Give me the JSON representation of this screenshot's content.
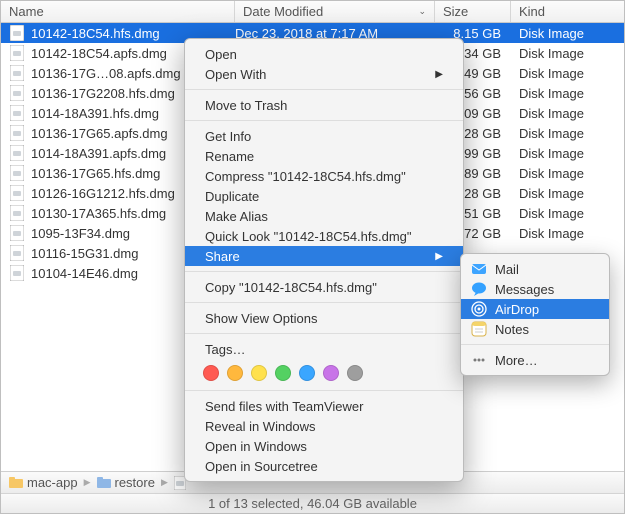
{
  "columns": {
    "name": "Name",
    "date": "Date Modified",
    "size": "Size",
    "kind": "Kind"
  },
  "sort_column": "date",
  "files": [
    {
      "name": "10142-18C54.hfs.dmg",
      "date": "Dec 23, 2018 at 7:17 AM",
      "size": "8.15 GB",
      "kind": "Disk Image",
      "selected": true
    },
    {
      "name": "10142-18C54.apfs.dmg",
      "date": "",
      "size": "34 GB",
      "kind": "Disk Image"
    },
    {
      "name": "10136-17G…08.apfs.dmg",
      "date": "",
      "size": "49 GB",
      "kind": "Disk Image"
    },
    {
      "name": "10136-17G2208.hfs.dmg",
      "date": "",
      "size": "56 GB",
      "kind": "Disk Image"
    },
    {
      "name": "1014-18A391.hfs.dmg",
      "date": "",
      "size": "09 GB",
      "kind": "Disk Image"
    },
    {
      "name": "10136-17G65.apfs.dmg",
      "date": "",
      "size": "28 GB",
      "kind": "Disk Image"
    },
    {
      "name": "1014-18A391.apfs.dmg",
      "date": "",
      "size": "99 GB",
      "kind": "Disk Image"
    },
    {
      "name": "10136-17G65.hfs.dmg",
      "date": "",
      "size": "89 GB",
      "kind": "Disk Image"
    },
    {
      "name": "10126-16G1212.hfs.dmg",
      "date": "",
      "size": "28 GB",
      "kind": "Disk Image"
    },
    {
      "name": "10130-17A365.hfs.dmg",
      "date": "",
      "size": "51 GB",
      "kind": "Disk Image"
    },
    {
      "name": "1095-13F34.dmg",
      "date": "",
      "size": "72 GB",
      "kind": "Disk Image"
    },
    {
      "name": "10116-15G31.dmg",
      "date": "",
      "size": "",
      "kind": ""
    },
    {
      "name": "10104-14E46.dmg",
      "date": "",
      "size": "",
      "kind": ""
    }
  ],
  "ctx": {
    "open": "Open",
    "open_with": "Open With",
    "trash": "Move to Trash",
    "get_info": "Get Info",
    "rename": "Rename",
    "compress": "Compress \"10142-18C54.hfs.dmg\"",
    "duplicate": "Duplicate",
    "alias": "Make Alias",
    "quicklook": "Quick Look \"10142-18C54.hfs.dmg\"",
    "share": "Share",
    "copy": "Copy \"10142-18C54.hfs.dmg\"",
    "view_opts": "Show View Options",
    "tags": "Tags…",
    "teamviewer": "Send files with TeamViewer",
    "reveal": "Reveal in Windows",
    "open_win": "Open in Windows",
    "sourcetree": "Open in Sourcetree"
  },
  "tag_colors": [
    "#ff5a52",
    "#ffb83d",
    "#ffe14d",
    "#54d162",
    "#3aa6ff",
    "#c874e8",
    "#9e9e9e"
  ],
  "share_sub": {
    "mail": "Mail",
    "messages": "Messages",
    "airdrop": "AirDrop",
    "notes": "Notes",
    "more": "More…"
  },
  "path": {
    "seg1": "mac-app",
    "seg2": "restore",
    "seg3": ""
  },
  "status": "1 of 13 selected, 46.04 GB available"
}
